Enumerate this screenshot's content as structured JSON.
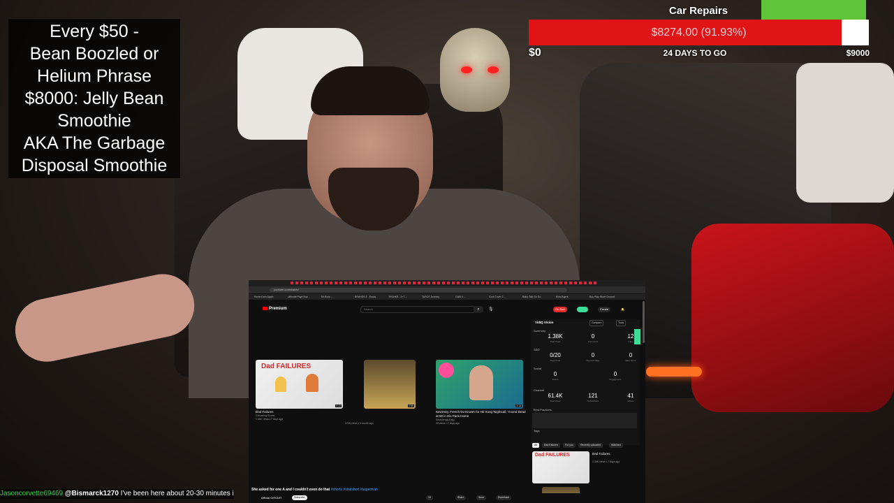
{
  "goal_text": "Every $50 -\nBean Boozled or\nHelium Phrase\n$8000: Jelly Bean\nSmoothie\nAKA The Garbage\nDisposal Smoothie",
  "donation_goal": {
    "title": "Car Repairs",
    "amount_label": "$8274.00 (91.93%)",
    "progress_fraction": 0.9193,
    "min_label": "$0",
    "days_label": "24 DAYS TO GO",
    "max_label": "$9000",
    "fill_color": "#e01317"
  },
  "chat": {
    "username": "Jasoncorvette69469",
    "mention": "@Bismarck1270",
    "message": "I've been here about 20-30 minutes i"
  },
  "browser": {
    "url": "youtube.com/watch/",
    "bookmarks": [
      "Home Earn Again",
      "Ultimate Faye Nuo",
      "Mr Boss - ...",
      "BRANDS 2 - Essay",
      "TRUNKS - 2+7 ...",
      "TAROT Journey",
      "GAM 4 ...",
      "Cool Cover 2 ...",
      "Baby Talk Go Go",
      "Mind Agent",
      "Buy Play Store Ground"
    ],
    "youtube": {
      "logo": "Premium",
      "search_placeholder": "Search",
      "search_icon": "search-icon",
      "mic_icon": "mic-icon",
      "header_buttons": [
        "Go Red",
        "Create"
      ],
      "videos": [
        {
          "thumb_text": "Dad FAILURES",
          "duration": "0:13",
          "title": "Dad Failures",
          "channel": "Grimacing Shorts",
          "meta": "1.38K views • 7 days ago"
        },
        {
          "thumb_text": "",
          "duration": "0:55",
          "title": "",
          "channel": "",
          "meta": "572K views • 1 month ago"
        },
        {
          "thumb_text": "",
          "duration": "3:13",
          "title": "Kavinsky, French DJ Known for Hit Song 'Nightcall,' Found Dead at 50 in His Paris Home",
          "channel": "Smashingly Daily",
          "meta": "22 views • 7 days ago"
        }
      ],
      "caption_text": "She asked for one A and I couldn't even do that",
      "caption_tags": "#shorts #viralshort #superman",
      "channel_name": "Official CIRCUIT",
      "subscribe_label": "Subscribe",
      "actions": [
        "12",
        "Share",
        "Save",
        "Download"
      ]
    },
    "vidiq": {
      "title": "VidIQ Vision",
      "buttons": [
        "Compare",
        "Tools"
      ],
      "summary_label": "Summary",
      "stats_row1": [
        {
          "value": "1.38K",
          "label": "Total Views"
        },
        {
          "value": "0",
          "label": "Comments"
        },
        {
          "value": "12",
          "label": "Likes"
        }
      ],
      "seo_label": "SEO",
      "stats_row2": [
        {
          "value": "0/20",
          "label": "Tags Used"
        },
        {
          "value": "0",
          "label": "Keyword Tags"
        },
        {
          "value": "0",
          "label": "SEO Score"
        }
      ],
      "social_label": "Social",
      "stats_row3": [
        {
          "value": "0",
          "label": "Shares"
        },
        {
          "value": "0",
          "label": "Engagement"
        }
      ],
      "channel_label": "Channel",
      "stats_row4": [
        {
          "value": "61.4K",
          "label": "Total Views"
        },
        {
          "value": "121",
          "label": "Subscribers"
        },
        {
          "value": "41",
          "label": "Videos"
        }
      ],
      "best_practices_label": "Best Practices",
      "tags_label": "Tags",
      "chips": [
        "All",
        "Dad Failures",
        "For you",
        "Recently uploaded",
        "Watched"
      ],
      "side_video_title": "Dad Failures",
      "side_video_meta": "1.38K views • 7 days ago"
    }
  }
}
